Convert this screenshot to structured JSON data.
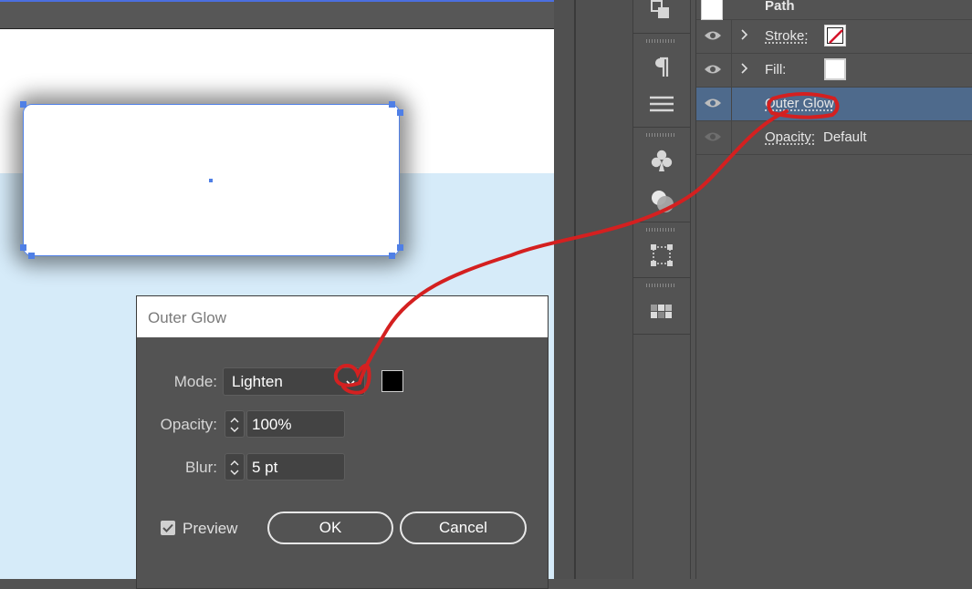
{
  "dialog": {
    "title": "Outer Glow",
    "mode_label": "Mode:",
    "mode_value": "Lighten",
    "opacity_label": "Opacity:",
    "opacity_value": "100%",
    "blur_label": "Blur:",
    "blur_value": "5 pt",
    "preview_label": "Preview",
    "preview_checked": true,
    "ok_label": "OK",
    "cancel_label": "Cancel",
    "glow_color": "#000000"
  },
  "appearance": {
    "path_label": "Path",
    "stroke_label": "Stroke:",
    "fill_label": "Fill:",
    "outer_glow_label": "Outer Glow",
    "opacity_label": "Opacity:",
    "opacity_value": "Default",
    "selected_row_color": "#4e6a8c"
  },
  "tools": [
    "arrange-icon",
    "paragraph-icon",
    "align-icon",
    "symbols-icon",
    "transparency-icon",
    "transform-icon",
    "swatches-icon"
  ],
  "colors": {
    "selection": "#4f7fe6",
    "annotation": "#d42020",
    "canvas_blue": "#d6ebf9"
  }
}
